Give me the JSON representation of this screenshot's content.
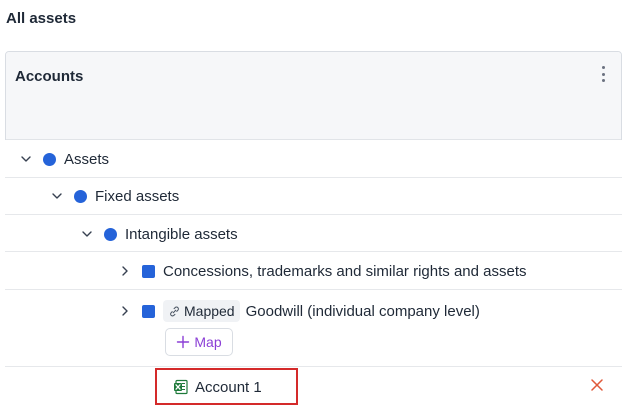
{
  "page": {
    "title": "All assets"
  },
  "panel": {
    "title": "Accounts",
    "menu_icon": "kebab-menu-icon"
  },
  "tree": {
    "assets": {
      "label": "Assets",
      "color": "#2563d9"
    },
    "fixed_assets": {
      "label": "Fixed assets",
      "color": "#2563d9"
    },
    "intangible_assets": {
      "label": "Intangible assets",
      "color": "#2563d9"
    },
    "concessions": {
      "label": "Concessions, trademarks and similar rights and assets",
      "color": "#2563d9"
    },
    "goodwill": {
      "label": "Goodwill (individual company level)",
      "badge": "Mapped",
      "map_button": "Map",
      "color": "#2563d9"
    },
    "account": {
      "label": "Account 1",
      "icon": "excel-icon"
    }
  },
  "colors": {
    "accent_purple": "#8b3fd6",
    "highlight_red": "#d42a2a",
    "remove_red": "#e0593a",
    "excel_green": "#1e7a3a"
  }
}
